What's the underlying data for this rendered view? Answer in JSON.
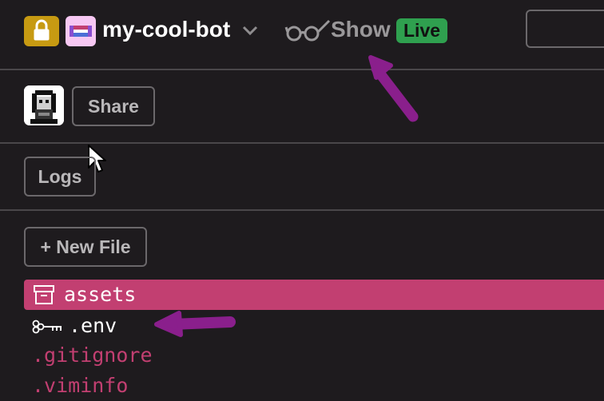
{
  "header": {
    "project_name": "my-cool-bot",
    "show_label": "Show",
    "live_badge": "Live"
  },
  "toolbar": {
    "share_label": "Share",
    "logs_label": "Logs",
    "new_file_label": "+ New File"
  },
  "files": [
    {
      "name": "assets",
      "icon": "archive-icon",
      "selected": true
    },
    {
      "name": ".env",
      "icon": "key-icon"
    },
    {
      "name": ".gitignore"
    },
    {
      "name": ".viminfo"
    }
  ],
  "colors": {
    "background": "#1e1b1e",
    "accent_pink": "#c23f71",
    "live_green": "#2fa04f",
    "lock_gold": "#c79a12",
    "annotation_purple": "#8a1f8c"
  }
}
